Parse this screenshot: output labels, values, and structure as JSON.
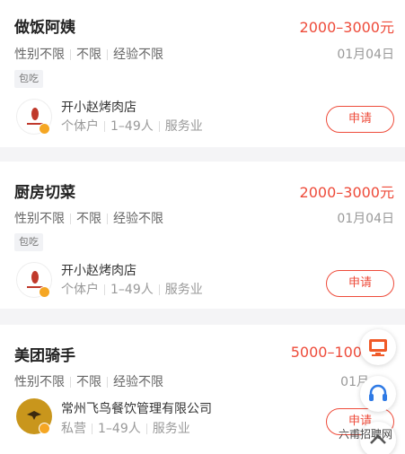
{
  "jobs": [
    {
      "title": "做饭阿姨",
      "salary": "2000–3000元",
      "reqs": [
        "性别不限",
        "不限",
        "经验不限"
      ],
      "date": "01月04日",
      "tag": "包吃",
      "company": "开小赵烤肉店",
      "cinfo": [
        "个体户",
        "1–49人",
        "服务业"
      ],
      "apply": "申请"
    },
    {
      "title": "厨房切菜",
      "salary": "2000–3000元",
      "reqs": [
        "性别不限",
        "不限",
        "经验不限"
      ],
      "date": "01月04日",
      "tag": "包吃",
      "company": "开小赵烤肉店",
      "cinfo": [
        "个体户",
        "1–49人",
        "服务业"
      ],
      "apply": "申请"
    },
    {
      "title": "美团骑手",
      "salary": "5000–100",
      "reqs": [
        "性别不限",
        "不限",
        "经验不限"
      ],
      "date": "01月",
      "company": "常州飞鸟餐饮管理有限公司",
      "cinfo": [
        "私营",
        "1–49人",
        "服务业"
      ],
      "apply": "申请"
    }
  ],
  "floating": {
    "icon1": "monitor-icon",
    "icon2": "headset-icon",
    "icon3": "chevron-up-icon"
  },
  "watermark": "六甫招聘网",
  "colors": {
    "accent": "#ee4b3a",
    "verified": "#f5a623",
    "float_orange": "#f05a28"
  }
}
